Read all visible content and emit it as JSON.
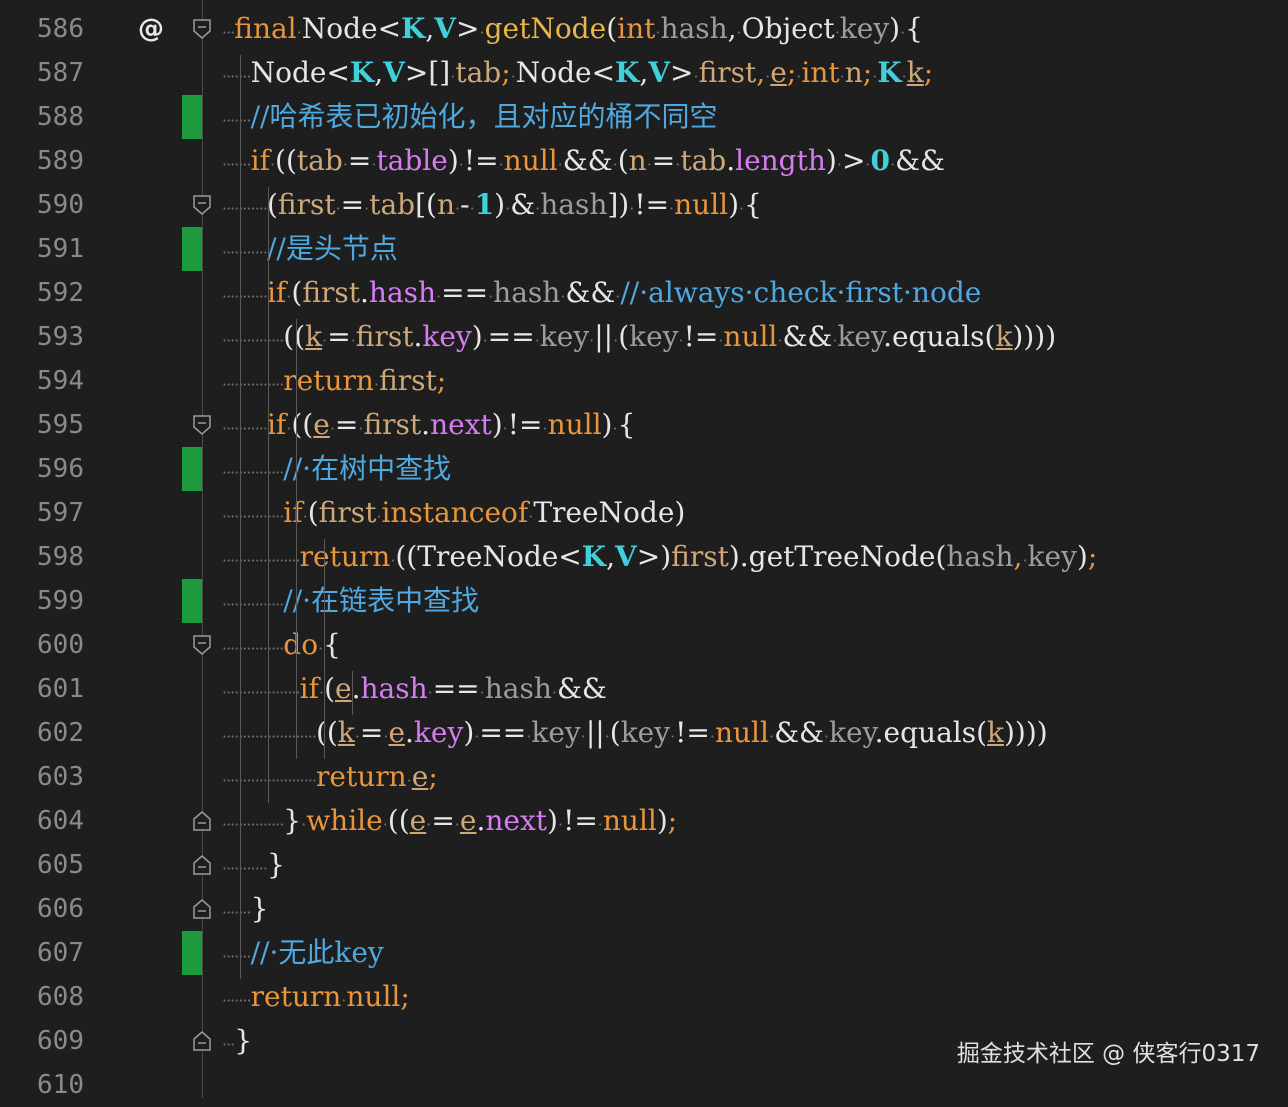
{
  "colors": {
    "background": "#1e1e1e",
    "keyword": "#e8953c",
    "type": "#e6e6e6",
    "generic": "#3fd0d9",
    "method": "#e8b64a",
    "param": "#9d9d9d",
    "field": "#d77cf2",
    "local": "#cfa87a",
    "comment": "#4fa8e0",
    "number": "#3fd0d9",
    "plain": "#e6e6e6",
    "change_marker": "#1d9a3b"
  },
  "gutter_marker": "@",
  "watermark": "掘金技术社区 @ 侠客行0317",
  "lines": [
    {
      "num": "586",
      "marker": true,
      "fold": "start",
      "change": false,
      "indent": 0,
      "tokens": [
        [
          "k",
          "final"
        ],
        [
          "d",
          "·"
        ],
        [
          "t",
          "Node<"
        ],
        [
          "g",
          "K"
        ],
        [
          "t",
          ","
        ],
        [
          "g",
          "V"
        ],
        [
          "t",
          ">"
        ],
        [
          "d",
          "·"
        ],
        [
          "m",
          "getNode"
        ],
        [
          "t",
          "("
        ],
        [
          "k",
          "int"
        ],
        [
          "d",
          "·"
        ],
        [
          "p",
          "hash"
        ],
        [
          "t",
          ","
        ],
        [
          "d",
          "·"
        ],
        [
          "t",
          "Object"
        ],
        [
          "d",
          "·"
        ],
        [
          "p",
          "key"
        ],
        [
          "t",
          ")"
        ],
        [
          "d",
          "·"
        ],
        [
          "t",
          "{"
        ]
      ]
    },
    {
      "num": "587",
      "marker": false,
      "fold": null,
      "change": false,
      "indent": 1,
      "tokens": [
        [
          "t",
          "Node<"
        ],
        [
          "g",
          "K"
        ],
        [
          "t",
          ","
        ],
        [
          "g",
          "V"
        ],
        [
          "t",
          ">[]"
        ],
        [
          "d",
          "·"
        ],
        [
          "l",
          "tab"
        ],
        [
          "k",
          ";"
        ],
        [
          "d",
          "·"
        ],
        [
          "t",
          "Node<"
        ],
        [
          "g",
          "K"
        ],
        [
          "t",
          ","
        ],
        [
          "g",
          "V"
        ],
        [
          "t",
          ">"
        ],
        [
          "d",
          "·"
        ],
        [
          "l",
          "first"
        ],
        [
          "k",
          ","
        ],
        [
          "d",
          "·"
        ],
        [
          "lu",
          "e"
        ],
        [
          "k",
          ";"
        ],
        [
          "d",
          "·"
        ],
        [
          "k",
          "int"
        ],
        [
          "d",
          "·"
        ],
        [
          "l",
          "n"
        ],
        [
          "k",
          ";"
        ],
        [
          "d",
          "·"
        ],
        [
          "g",
          "K"
        ],
        [
          "d",
          "·"
        ],
        [
          "lu",
          "k"
        ],
        [
          "k",
          ";"
        ]
      ]
    },
    {
      "num": "588",
      "marker": false,
      "fold": null,
      "change": true,
      "indent": 1,
      "tokens": [
        [
          "c",
          "//哈希表已初始化，且对应的桶不同空"
        ]
      ]
    },
    {
      "num": "589",
      "marker": false,
      "fold": null,
      "change": false,
      "indent": 1,
      "tokens": [
        [
          "k",
          "if"
        ],
        [
          "d",
          "·"
        ],
        [
          "t",
          "(("
        ],
        [
          "l",
          "tab"
        ],
        [
          "d",
          "·"
        ],
        [
          "t",
          "="
        ],
        [
          "d",
          "·"
        ],
        [
          "f",
          "table"
        ],
        [
          "t",
          ")"
        ],
        [
          "d",
          "·"
        ],
        [
          "t",
          "!="
        ],
        [
          "d",
          "·"
        ],
        [
          "k",
          "null"
        ],
        [
          "d",
          "·"
        ],
        [
          "t",
          "&&"
        ],
        [
          "d",
          "·"
        ],
        [
          "t",
          "("
        ],
        [
          "l",
          "n"
        ],
        [
          "d",
          "·"
        ],
        [
          "t",
          "="
        ],
        [
          "d",
          "·"
        ],
        [
          "l",
          "tab"
        ],
        [
          "t",
          "."
        ],
        [
          "f",
          "length"
        ],
        [
          "t",
          ")"
        ],
        [
          "d",
          "·"
        ],
        [
          "t",
          ">"
        ],
        [
          "d",
          "·"
        ],
        [
          "n",
          "0"
        ],
        [
          "d",
          "·"
        ],
        [
          "t",
          "&&"
        ]
      ]
    },
    {
      "num": "590",
      "marker": false,
      "fold": "start",
      "change": false,
      "indent": 2,
      "tokens": [
        [
          "t",
          "("
        ],
        [
          "l",
          "first"
        ],
        [
          "d",
          "·"
        ],
        [
          "t",
          "="
        ],
        [
          "d",
          "·"
        ],
        [
          "l",
          "tab"
        ],
        [
          "t",
          "[("
        ],
        [
          "l",
          "n"
        ],
        [
          "d",
          "·"
        ],
        [
          "t",
          "-"
        ],
        [
          "d",
          "·"
        ],
        [
          "n",
          "1"
        ],
        [
          "t",
          ")"
        ],
        [
          "d",
          "·"
        ],
        [
          "t",
          "&"
        ],
        [
          "d",
          "·"
        ],
        [
          "p",
          "hash"
        ],
        [
          "t",
          "])"
        ],
        [
          "d",
          "·"
        ],
        [
          "t",
          "!="
        ],
        [
          "d",
          "·"
        ],
        [
          "k",
          "null"
        ],
        [
          "t",
          ")"
        ],
        [
          "d",
          "·"
        ],
        [
          "t",
          "{"
        ]
      ]
    },
    {
      "num": "591",
      "marker": false,
      "fold": null,
      "change": true,
      "indent": 2,
      "tokens": [
        [
          "c",
          "//是头节点"
        ]
      ]
    },
    {
      "num": "592",
      "marker": false,
      "fold": null,
      "change": false,
      "indent": 2,
      "tokens": [
        [
          "k",
          "if"
        ],
        [
          "d",
          "·"
        ],
        [
          "t",
          "("
        ],
        [
          "l",
          "first"
        ],
        [
          "t",
          "."
        ],
        [
          "f",
          "hash"
        ],
        [
          "d",
          "·"
        ],
        [
          "t",
          "=="
        ],
        [
          "d",
          "·"
        ],
        [
          "p",
          "hash"
        ],
        [
          "d",
          "·"
        ],
        [
          "t",
          "&&"
        ],
        [
          "d",
          "·"
        ],
        [
          "c",
          "//·always·check·first·node"
        ]
      ]
    },
    {
      "num": "593",
      "marker": false,
      "fold": null,
      "change": false,
      "indent": 3,
      "tokens": [
        [
          "t",
          "(("
        ],
        [
          "lu",
          "k"
        ],
        [
          "d",
          "·"
        ],
        [
          "t",
          "="
        ],
        [
          "d",
          "·"
        ],
        [
          "l",
          "first"
        ],
        [
          "t",
          "."
        ],
        [
          "f",
          "key"
        ],
        [
          "t",
          ")"
        ],
        [
          "d",
          "·"
        ],
        [
          "t",
          "=="
        ],
        [
          "d",
          "·"
        ],
        [
          "p",
          "key"
        ],
        [
          "d",
          "·"
        ],
        [
          "t",
          "||"
        ],
        [
          "d",
          "·"
        ],
        [
          "t",
          "("
        ],
        [
          "p",
          "key"
        ],
        [
          "d",
          "·"
        ],
        [
          "t",
          "!="
        ],
        [
          "d",
          "·"
        ],
        [
          "k",
          "null"
        ],
        [
          "d",
          "·"
        ],
        [
          "t",
          "&&"
        ],
        [
          "d",
          "·"
        ],
        [
          "p",
          "key"
        ],
        [
          "t",
          ".equals("
        ],
        [
          "lu",
          "k"
        ],
        [
          "t",
          "))))"
        ]
      ]
    },
    {
      "num": "594",
      "marker": false,
      "fold": null,
      "change": false,
      "indent": 3,
      "tokens": [
        [
          "k",
          "return"
        ],
        [
          "d",
          "·"
        ],
        [
          "l",
          "first"
        ],
        [
          "k",
          ";"
        ]
      ]
    },
    {
      "num": "595",
      "marker": false,
      "fold": "start",
      "change": false,
      "indent": 2,
      "tokens": [
        [
          "k",
          "if"
        ],
        [
          "d",
          "·"
        ],
        [
          "t",
          "(("
        ],
        [
          "lu",
          "e"
        ],
        [
          "d",
          "·"
        ],
        [
          "t",
          "="
        ],
        [
          "d",
          "·"
        ],
        [
          "l",
          "first"
        ],
        [
          "t",
          "."
        ],
        [
          "f",
          "next"
        ],
        [
          "t",
          ")"
        ],
        [
          "d",
          "·"
        ],
        [
          "t",
          "!="
        ],
        [
          "d",
          "·"
        ],
        [
          "k",
          "null"
        ],
        [
          "t",
          ")"
        ],
        [
          "d",
          "·"
        ],
        [
          "t",
          "{"
        ]
      ]
    },
    {
      "num": "596",
      "marker": false,
      "fold": null,
      "change": true,
      "indent": 3,
      "tokens": [
        [
          "c",
          "//·在树中查找"
        ]
      ]
    },
    {
      "num": "597",
      "marker": false,
      "fold": null,
      "change": false,
      "indent": 3,
      "tokens": [
        [
          "k",
          "if"
        ],
        [
          "d",
          "·"
        ],
        [
          "t",
          "("
        ],
        [
          "l",
          "first"
        ],
        [
          "d",
          "·"
        ],
        [
          "k",
          "instanceof"
        ],
        [
          "d",
          "·"
        ],
        [
          "t",
          "TreeNode)"
        ]
      ]
    },
    {
      "num": "598",
      "marker": false,
      "fold": null,
      "change": false,
      "indent": 4,
      "tokens": [
        [
          "k",
          "return"
        ],
        [
          "d",
          "·"
        ],
        [
          "t",
          "((TreeNode<"
        ],
        [
          "g",
          "K"
        ],
        [
          "t",
          ","
        ],
        [
          "g",
          "V"
        ],
        [
          "t",
          ">)"
        ],
        [
          "l",
          "first"
        ],
        [
          "t",
          ").getTreeNode("
        ],
        [
          "p",
          "hash"
        ],
        [
          "k",
          ","
        ],
        [
          "d",
          "·"
        ],
        [
          "p",
          "key"
        ],
        [
          "t",
          ")"
        ],
        [
          "k",
          ";"
        ]
      ]
    },
    {
      "num": "599",
      "marker": false,
      "fold": null,
      "change": true,
      "indent": 3,
      "tokens": [
        [
          "c",
          "//·在链表中查找"
        ]
      ]
    },
    {
      "num": "600",
      "marker": false,
      "fold": "start",
      "change": false,
      "indent": 3,
      "tokens": [
        [
          "k",
          "do"
        ],
        [
          "d",
          "·"
        ],
        [
          "t",
          "{"
        ]
      ]
    },
    {
      "num": "601",
      "marker": false,
      "fold": null,
      "change": false,
      "indent": 4,
      "tokens": [
        [
          "k",
          "if"
        ],
        [
          "d",
          "·"
        ],
        [
          "t",
          "("
        ],
        [
          "lu",
          "e"
        ],
        [
          "t",
          "."
        ],
        [
          "f",
          "hash"
        ],
        [
          "d",
          "·"
        ],
        [
          "t",
          "=="
        ],
        [
          "d",
          "·"
        ],
        [
          "p",
          "hash"
        ],
        [
          "d",
          "·"
        ],
        [
          "t",
          "&&"
        ]
      ]
    },
    {
      "num": "602",
      "marker": false,
      "fold": null,
      "change": false,
      "indent": 5,
      "tokens": [
        [
          "t",
          "(("
        ],
        [
          "lu",
          "k"
        ],
        [
          "d",
          "·"
        ],
        [
          "t",
          "="
        ],
        [
          "d",
          "·"
        ],
        [
          "lu",
          "e"
        ],
        [
          "t",
          "."
        ],
        [
          "f",
          "key"
        ],
        [
          "t",
          ")"
        ],
        [
          "d",
          "·"
        ],
        [
          "t",
          "=="
        ],
        [
          "d",
          "·"
        ],
        [
          "p",
          "key"
        ],
        [
          "d",
          "·"
        ],
        [
          "t",
          "||"
        ],
        [
          "d",
          "·"
        ],
        [
          "t",
          "("
        ],
        [
          "p",
          "key"
        ],
        [
          "d",
          "·"
        ],
        [
          "t",
          "!="
        ],
        [
          "d",
          "·"
        ],
        [
          "k",
          "null"
        ],
        [
          "d",
          "·"
        ],
        [
          "t",
          "&&"
        ],
        [
          "d",
          "·"
        ],
        [
          "p",
          "key"
        ],
        [
          "t",
          ".equals("
        ],
        [
          "lu",
          "k"
        ],
        [
          "t",
          "))))"
        ]
      ]
    },
    {
      "num": "603",
      "marker": false,
      "fold": null,
      "change": false,
      "indent": 5,
      "tokens": [
        [
          "k",
          "return"
        ],
        [
          "d",
          "·"
        ],
        [
          "lu",
          "e"
        ],
        [
          "k",
          ";"
        ]
      ]
    },
    {
      "num": "604",
      "marker": false,
      "fold": "end",
      "change": false,
      "indent": 3,
      "tokens": [
        [
          "t",
          "}"
        ],
        [
          "d",
          "·"
        ],
        [
          "k",
          "while"
        ],
        [
          "d",
          "·"
        ],
        [
          "t",
          "(("
        ],
        [
          "lu",
          "e"
        ],
        [
          "d",
          "·"
        ],
        [
          "t",
          "="
        ],
        [
          "d",
          "·"
        ],
        [
          "lu",
          "e"
        ],
        [
          "t",
          "."
        ],
        [
          "f",
          "next"
        ],
        [
          "t",
          ")"
        ],
        [
          "d",
          "·"
        ],
        [
          "t",
          "!="
        ],
        [
          "d",
          "·"
        ],
        [
          "k",
          "null"
        ],
        [
          "t",
          ")"
        ],
        [
          "k",
          ";"
        ]
      ]
    },
    {
      "num": "605",
      "marker": false,
      "fold": "end",
      "change": false,
      "indent": 2,
      "tokens": [
        [
          "t",
          "}"
        ]
      ]
    },
    {
      "num": "606",
      "marker": false,
      "fold": "end",
      "change": false,
      "indent": 1,
      "tokens": [
        [
          "t",
          "}"
        ]
      ]
    },
    {
      "num": "607",
      "marker": false,
      "fold": null,
      "change": true,
      "indent": 1,
      "tokens": [
        [
          "c",
          "//·无此key"
        ]
      ]
    },
    {
      "num": "608",
      "marker": false,
      "fold": null,
      "change": false,
      "indent": 1,
      "tokens": [
        [
          "k",
          "return"
        ],
        [
          "d",
          "·"
        ],
        [
          "k",
          "null;"
        ]
      ]
    },
    {
      "num": "609",
      "marker": false,
      "fold": "end",
      "change": false,
      "indent": 0,
      "tokens": [
        [
          "t",
          "}"
        ]
      ]
    },
    {
      "num": "610",
      "marker": false,
      "fold": null,
      "change": false,
      "indent": 0,
      "tokens": []
    }
  ]
}
